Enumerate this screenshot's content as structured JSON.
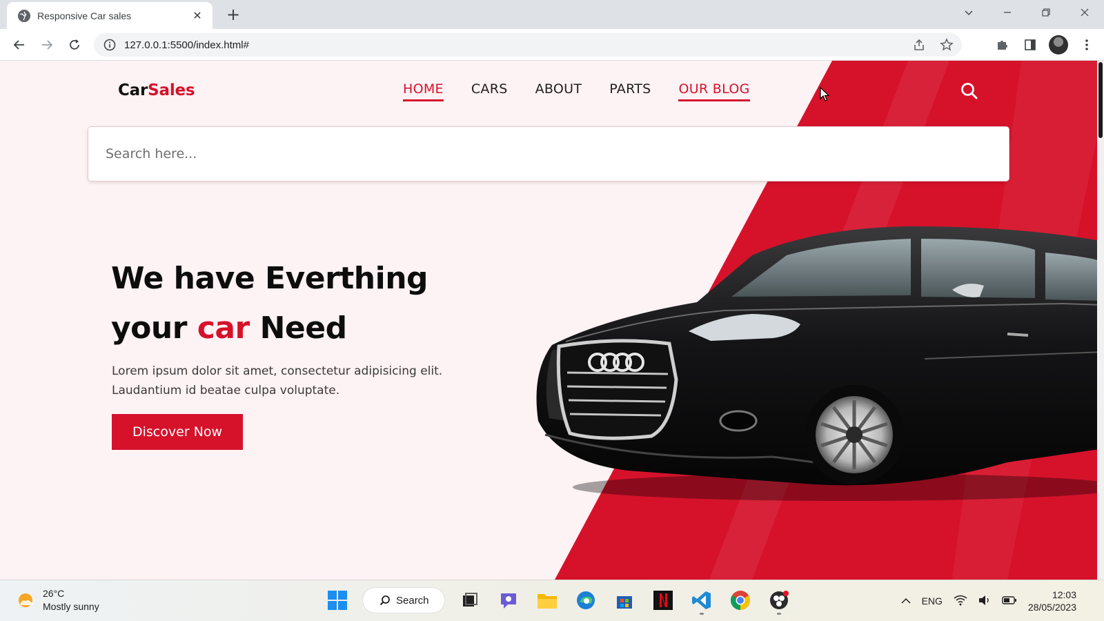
{
  "browser": {
    "tab_title": "Responsive Car sales",
    "url": "127.0.0.1:5500/index.html#"
  },
  "site": {
    "logo_part1": "Car",
    "logo_part2": "Sales",
    "nav": [
      {
        "label": "HOME",
        "active": true
      },
      {
        "label": "CARS",
        "active": false
      },
      {
        "label": "ABOUT",
        "active": false
      },
      {
        "label": "PARTS",
        "active": false
      },
      {
        "label": "OUR BLOG",
        "active": true
      }
    ],
    "search_placeholder": "Search here...",
    "headline_line1": "We have Everthing",
    "headline_line2_pre": "your ",
    "headline_line2_accent": "car",
    "headline_line2_post": " Need",
    "description": "Lorem ipsum dolor sit amet, consectetur adipisicing elit. Laudantium id beatae culpa voluptate.",
    "cta_label": "Discover Now",
    "accent_color": "#d6122b"
  },
  "taskbar": {
    "weather_temp": "26°C",
    "weather_desc": "Mostly sunny",
    "search_label": "Search",
    "language": "ENG",
    "time": "12:03",
    "date": "28/05/2023"
  }
}
